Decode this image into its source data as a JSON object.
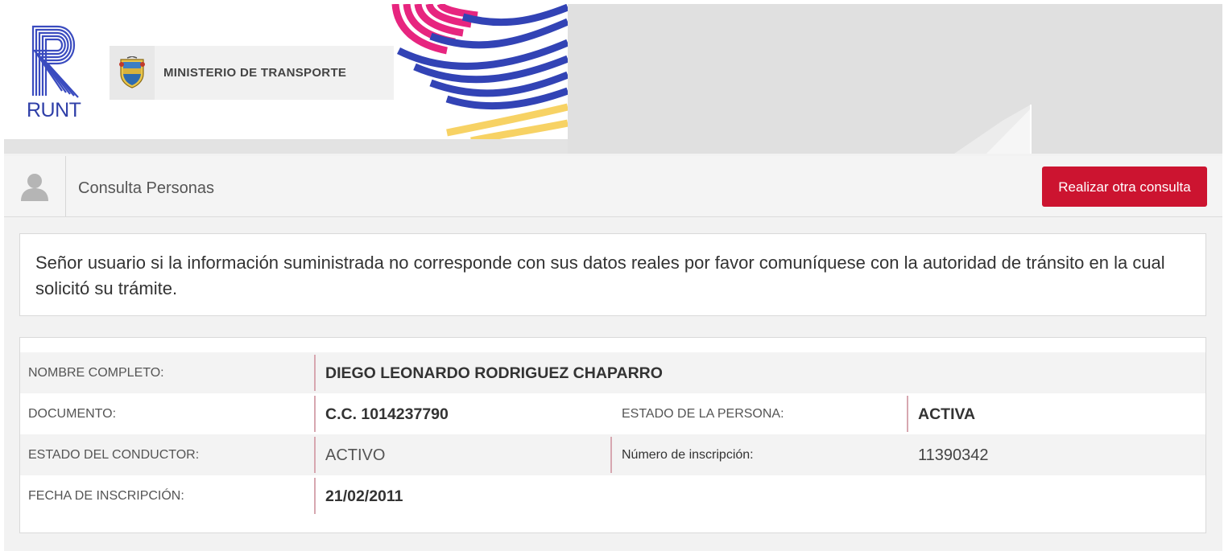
{
  "banner": {
    "logo_text": "RUNT",
    "ministry": "MINISTERIO DE TRANSPORTE",
    "icons": {
      "logo": "runt-logo-icon",
      "shield": "colombia-shield-icon"
    },
    "colors": {
      "brand_blue": "#2f3fa8",
      "wave_pink": "#e7257f",
      "wave_yellow": "#f7d264"
    }
  },
  "header": {
    "title": "Consulta Personas",
    "action_label": "Realizar otra consulta",
    "icon": "user-icon",
    "colors": {
      "action_bg": "#cc1430"
    }
  },
  "notice": {
    "text": "Señor usuario si la información suministrada no corresponde con sus datos reales por favor comuníquese con la autoridad de tránsito en la cual solicitó su trámite."
  },
  "person": {
    "nombre_label": "NOMBRE COMPLETO:",
    "nombre_value": "DIEGO LEONARDO RODRIGUEZ CHAPARRO",
    "documento_label": "DOCUMENTO:",
    "documento_value": "C.C. 1014237790",
    "estado_persona_label": "ESTADO DE LA PERSONA:",
    "estado_persona_value": "ACTIVA",
    "estado_conductor_label": "ESTADO DEL CONDUCTOR:",
    "estado_conductor_value": "ACTIVO",
    "numero_label": "Número de inscripción:",
    "numero_value": "11390342",
    "fecha_label": "FECHA DE INSCRIPCIÓN:",
    "fecha_value": "21/02/2011"
  }
}
